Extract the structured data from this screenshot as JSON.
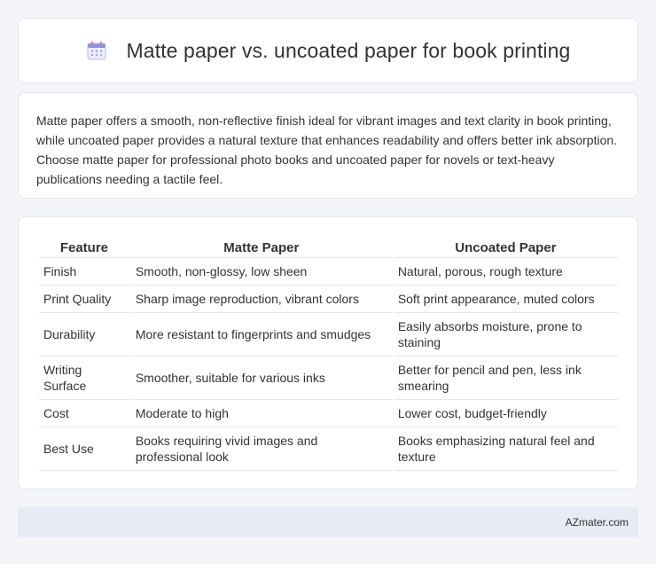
{
  "header": {
    "title": "Matte paper vs. uncoated paper for book printing",
    "icon": "calendar-icon"
  },
  "summary": {
    "text": "Matte paper offers a smooth, non-reflective finish ideal for vibrant images and text clarity in book printing, while uncoated paper provides a natural texture that enhances readability and offers better ink absorption. Choose matte paper for professional photo books and uncoated paper for novels or text-heavy publications needing a tactile feel."
  },
  "table": {
    "headers": [
      "Feature",
      "Matte Paper",
      "Uncoated Paper"
    ],
    "rows": [
      [
        "Finish",
        "Smooth, non-glossy, low sheen",
        "Natural, porous, rough texture"
      ],
      [
        "Print Quality",
        "Sharp image reproduction, vibrant colors",
        "Soft print appearance, muted colors"
      ],
      [
        "Durability",
        "More resistant to fingerprints and smudges",
        "Easily absorbs moisture, prone to staining"
      ],
      [
        "Writing Surface",
        "Smoother, suitable for various inks",
        "Better for pencil and pen, less ink smearing"
      ],
      [
        "Cost",
        "Moderate to high",
        "Lower cost, budget-friendly"
      ],
      [
        "Best Use",
        "Books requiring vivid images and professional look",
        "Books emphasizing natural feel and texture"
      ]
    ]
  },
  "footer": {
    "site": "AZmater.com"
  },
  "colors": {
    "background": "#f4f5f8",
    "card": "#ffffff",
    "border": "#e3e6ec",
    "footer_bg": "#e6ebf5",
    "icon_accent": "#7b7fd4"
  }
}
